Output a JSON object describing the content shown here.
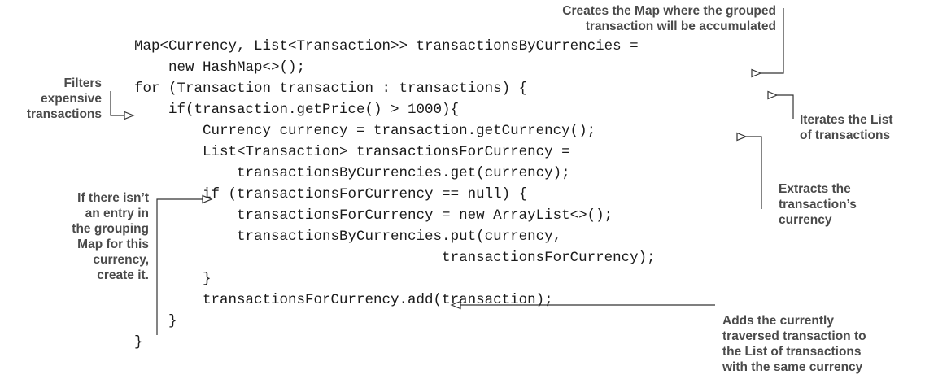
{
  "code": {
    "lines": [
      "Map<Currency, List<Transaction>> transactionsByCurrencies =",
      "    new HashMap<>();",
      "for (Transaction transaction : transactions) {",
      "    if(transaction.getPrice() > 1000){",
      "        Currency currency = transaction.getCurrency();",
      "        List<Transaction> transactionsForCurrency =",
      "            transactionsByCurrencies.get(currency);",
      "        if (transactionsForCurrency == null) {",
      "            transactionsForCurrency = new ArrayList<>();",
      "            transactionsByCurrencies.put(currency,",
      "                                    transactionsForCurrency);",
      "        }",
      "        transactionsForCurrency.add(transaction);",
      "    }",
      "}"
    ]
  },
  "annotations": {
    "create_map": [
      "Creates the Map where the grouped",
      "transaction will be accumulated"
    ],
    "filter": [
      "Filters",
      "expensive",
      "transactions"
    ],
    "iterate": [
      "Iterates the List",
      "of transactions"
    ],
    "extract": [
      "Extracts the",
      "transaction’s",
      "currency"
    ],
    "create_entry": [
      "If there isn’t",
      "an entry in",
      "the grouping",
      "Map for this",
      "currency,",
      "create it."
    ],
    "add": [
      "Adds the currently",
      "traversed transaction to",
      "the List of transactions",
      "with the same currency"
    ]
  }
}
